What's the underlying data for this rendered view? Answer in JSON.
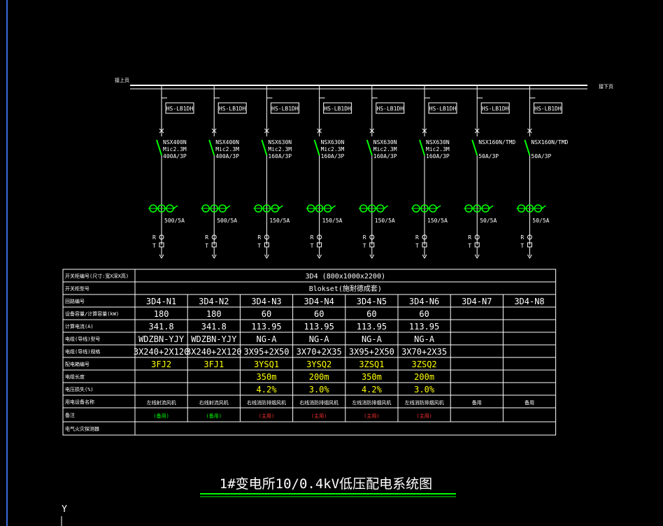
{
  "colors": {
    "background": "#000000",
    "line": "#ffffff",
    "breaker": "#00ff00",
    "ct": "#00ff00",
    "highlight": "#ffff00",
    "warning": "#ff3030",
    "title_underline": "#00ff00",
    "left_border": "#3a6cd8"
  },
  "bus": {
    "left_label": "接上页",
    "right_label": "接下页"
  },
  "feeders": [
    {
      "meter": "HS-LB1DH",
      "breaker_model": "NSX400N",
      "trip_unit": "Mic2.3M",
      "rating": "400A/3P",
      "ct_ratio": "500/5A"
    },
    {
      "meter": "HS-LB1DH",
      "breaker_model": "NSX400N",
      "trip_unit": "Mic2.3M",
      "rating": "400A/3P",
      "ct_ratio": "500/5A"
    },
    {
      "meter": "HS-LB1DH",
      "breaker_model": "NSX630N",
      "trip_unit": "Mic2.3M",
      "rating": "160A/3P",
      "ct_ratio": "150/5A"
    },
    {
      "meter": "HS-LB1DH",
      "breaker_model": "NSX630N",
      "trip_unit": "Mic2.3M",
      "rating": "160A/3P",
      "ct_ratio": "150/5A"
    },
    {
      "meter": "HS-LB1DH",
      "breaker_model": "NSX630N",
      "trip_unit": "Mic2.3M",
      "rating": "160A/3P",
      "ct_ratio": "150/5A"
    },
    {
      "meter": "HS-LB1DH",
      "breaker_model": "NSX630N",
      "trip_unit": "Mic2.3M",
      "rating": "160A/3P",
      "ct_ratio": "150/5A"
    },
    {
      "meter": "HS-LB1DH",
      "breaker_model": "NSX160N/TMD",
      "trip_unit": "",
      "rating": "50A/3P",
      "ct_ratio": "50/5A"
    },
    {
      "meter": "HS-LB1DH",
      "breaker_model": "NSX160N/TMD",
      "trip_unit": "",
      "rating": "50A/3P",
      "ct_ratio": "50/5A"
    }
  ],
  "relay": {
    "r_label": "R",
    "t_label": "T"
  },
  "table": {
    "rows": [
      {
        "label": "开关柜编号(尺寸:宽X深X高)",
        "span_value": "3D4 (800x1000x2200)"
      },
      {
        "label": "开关柜型号",
        "span_value": "Blokset(施耐德成套)"
      },
      {
        "label": "回路编号",
        "values": [
          "3D4-N1",
          "3D4-N2",
          "3D4-N3",
          "3D4-N4",
          "3D4-N5",
          "3D4-N6",
          "3D4-N7",
          "3D4-N8"
        ]
      },
      {
        "label": "设备容量/计算容量(kW)",
        "values": [
          "180",
          "180",
          "60",
          "60",
          "60",
          "60",
          "",
          ""
        ]
      },
      {
        "label": "计算电流(A)",
        "values": [
          "341.8",
          "341.8",
          "113.95",
          "113.95",
          "113.95",
          "113.95",
          "",
          ""
        ]
      },
      {
        "label": "电缆(导线)型号",
        "values": [
          "WDZBN-YJY",
          "WDZBN-YJY",
          "NG-A",
          "NG-A",
          "NG-A",
          "NG-A",
          "",
          ""
        ]
      },
      {
        "label": "电缆(导线)规格",
        "values": [
          "3X240+2X120",
          "3X240+2X120",
          "3X95+2X50",
          "3X70+2X35",
          "3X95+2X50",
          "3X70+2X35",
          "",
          ""
        ]
      },
      {
        "label": "配电箱编号",
        "values": [
          "3FJ2",
          "3FJ1",
          "3YSQ1",
          "3YSQ2",
          "3ZSQ1",
          "3ZSQ2",
          "",
          ""
        ],
        "color": "highlight"
      },
      {
        "label": "电缆长度",
        "values": [
          "",
          "",
          "350m",
          "200m",
          "350m",
          "200m",
          "",
          ""
        ],
        "color": "highlight"
      },
      {
        "label": "电压损失(%)",
        "values": [
          "",
          "",
          "4.2%",
          "3.0%",
          "4.2%",
          "3.0%",
          "",
          ""
        ],
        "color": "highlight"
      },
      {
        "label": "用电设备名称",
        "values": [
          "左线射流风机",
          "右线射流风机",
          "右线消防排烟风机",
          "右线消防排烟风机",
          "左线消防排烟风机",
          "左线消防排烟风机",
          "备用",
          "备用"
        ],
        "small": true
      },
      {
        "label": "备注",
        "values": [
          "(备用)",
          "(备用)",
          "(主用)",
          "(主用)",
          "(主用)",
          "(主用)",
          "",
          ""
        ],
        "small": true,
        "colors": [
          "breaker",
          "breaker",
          "warning",
          "warning",
          "warning",
          "warning",
          "",
          ""
        ]
      },
      {
        "label": "电气火灾探测器",
        "values": [
          "",
          "",
          "",
          "",
          "",
          "",
          "",
          ""
        ]
      }
    ]
  },
  "title": "1#变电所10/0.4kV低压配电系统图",
  "axis_label": "Y"
}
